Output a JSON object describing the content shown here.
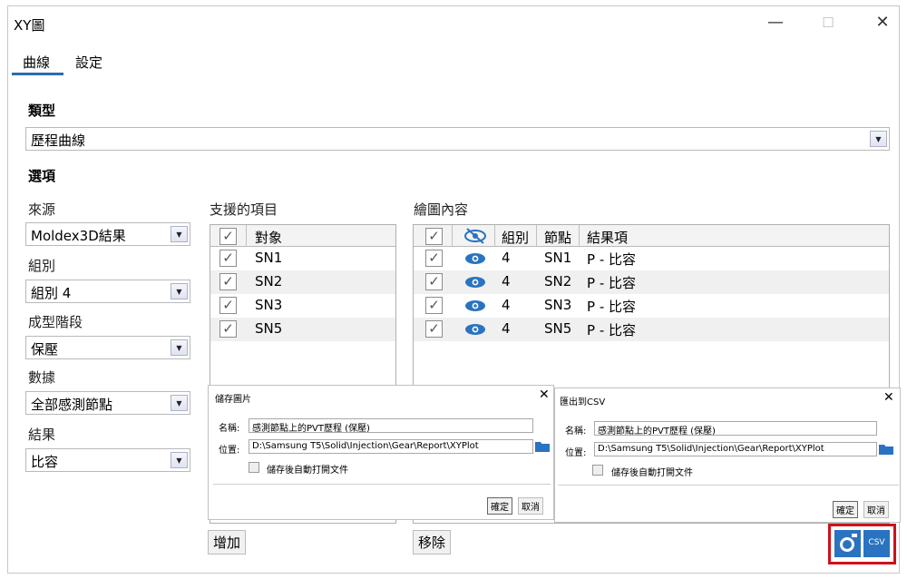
{
  "window": {
    "title": "XY圖",
    "minimize": "—",
    "maximize": "☐",
    "close": "✕"
  },
  "tabs": [
    {
      "label": "曲線"
    },
    {
      "label": "設定"
    }
  ],
  "type_section": {
    "label": "類型",
    "value": "歷程曲線"
  },
  "options_section": {
    "label": "選項"
  },
  "source": {
    "label": "來源",
    "value": "Moldex3D結果"
  },
  "group": {
    "label": "組別",
    "value": "組別 4"
  },
  "stage": {
    "label": "成型階段",
    "value": "保壓"
  },
  "data": {
    "label": "數據",
    "value": "全部感測節點"
  },
  "result": {
    "label": "結果",
    "value": "比容"
  },
  "supported": {
    "label": "支援的項目",
    "header": "對象",
    "items": [
      "SN1",
      "SN2",
      "SN3",
      "SN5"
    ]
  },
  "plot": {
    "label": "繪圖內容",
    "headers": {
      "group": "組別",
      "node": "節點",
      "result": "結果項"
    },
    "rows": [
      {
        "group": "4",
        "node": "SN1",
        "result": "P - 比容"
      },
      {
        "group": "4",
        "node": "SN2",
        "result": "P - 比容"
      },
      {
        "group": "4",
        "node": "SN3",
        "result": "P - 比容"
      },
      {
        "group": "4",
        "node": "SN5",
        "result": "P - 比容"
      }
    ]
  },
  "add_button": "增加",
  "remove_button": "移除",
  "save_image_dialog": {
    "title": "儲存圖片",
    "name_label": "名稱:",
    "name_value": "感測節點上的PVT歷程 (保壓)",
    "location_label": "位置:",
    "location_value": "D:\\Samsung T5\\Solid\\Injection\\Gear\\Report\\XYPlot",
    "auto_open_label": "儲存後自動打開文件",
    "ok": "確定",
    "cancel": "取消"
  },
  "export_csv_dialog": {
    "title": "匯出到CSV",
    "name_label": "名稱:",
    "name_value": "感測節點上的PVT歷程 (保壓)",
    "location_label": "位置:",
    "location_value": "D:\\Samsung T5\\Solid\\Injection\\Gear\\Report\\XYPlot",
    "auto_open_label": "儲存後自動打開文件",
    "ok": "確定",
    "cancel": "取消"
  },
  "csv_icon_label": "CSV",
  "colors": {
    "accent": "#2b6cb0",
    "icon_blue": "#2a73c0",
    "highlight_border": "#d0101a"
  }
}
